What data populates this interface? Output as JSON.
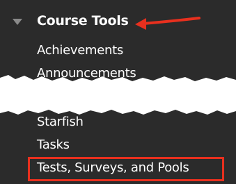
{
  "course_tools": {
    "header_label": "Course Tools",
    "toggle_icon": "triangle-down-icon",
    "items": [
      {
        "label": "Achievements"
      },
      {
        "label": "Announcements"
      },
      {
        "label": "Starfish"
      },
      {
        "label": "Tasks"
      },
      {
        "label": "Tests, Surveys, and Pools"
      }
    ]
  },
  "annotations": {
    "arrow_color": "#e8301e",
    "highlight_color": "#e8301e"
  },
  "colors": {
    "panel_background": "#2b2b2b",
    "text": "#ffffff"
  }
}
